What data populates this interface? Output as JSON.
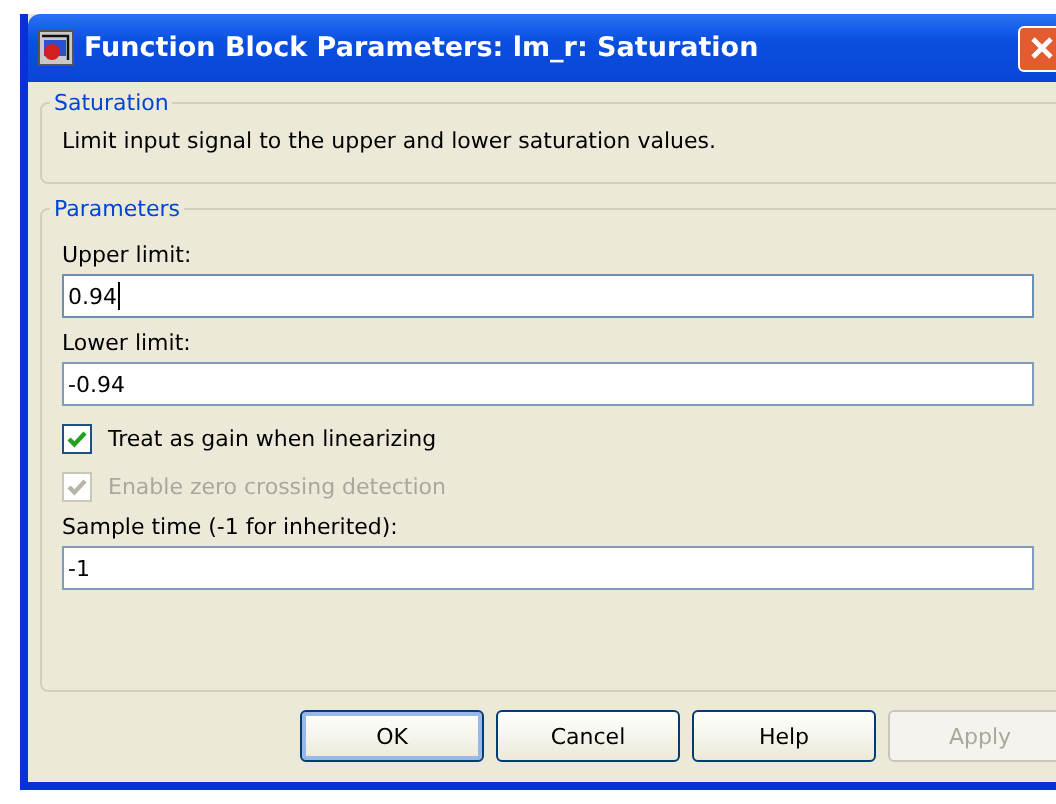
{
  "window": {
    "title": "Function Block Parameters: lm_r: Saturation"
  },
  "description_group": {
    "title": "Saturation",
    "text": "Limit input signal to the upper and lower saturation values."
  },
  "parameters_group": {
    "title": "Parameters",
    "items": [
      {
        "kind": "field",
        "label": "Upper limit:",
        "value": "0.94",
        "focused": true
      },
      {
        "kind": "field",
        "label": "Lower limit:",
        "value": "-0.94",
        "focused": false
      },
      {
        "kind": "checkbox",
        "label": "Treat as gain when linearizing",
        "checked": true,
        "disabled": false
      },
      {
        "kind": "checkbox",
        "label": "Enable zero crossing detection",
        "checked": true,
        "disabled": true
      },
      {
        "kind": "field",
        "label": "Sample time (-1 for inherited):",
        "value": "-1",
        "focused": false
      }
    ]
  },
  "buttons": [
    {
      "label": "OK",
      "default": true,
      "disabled": false
    },
    {
      "label": "Cancel",
      "default": false,
      "disabled": false
    },
    {
      "label": "Help",
      "default": false,
      "disabled": false
    },
    {
      "label": "Apply",
      "default": false,
      "disabled": true
    }
  ]
}
